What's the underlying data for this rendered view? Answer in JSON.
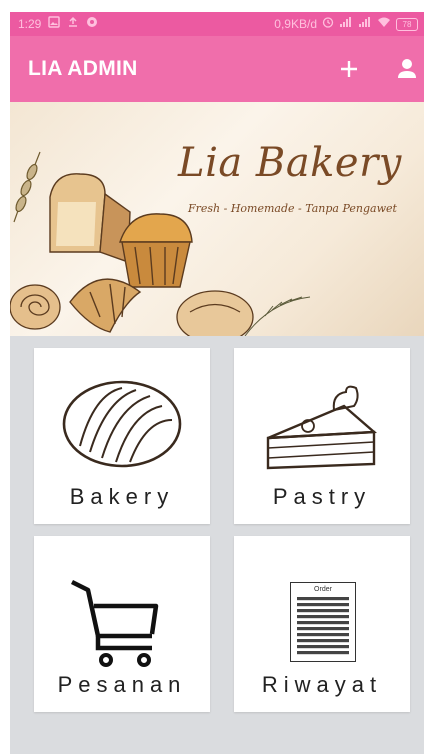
{
  "status_bar": {
    "time": "1:29",
    "network_speed": "0,9KB/d",
    "battery": "78",
    "icons": [
      "gallery-notification-icon",
      "upload-icon",
      "app-notification-icon",
      "alarm-icon",
      "signal-icon",
      "signal-icon",
      "wifi-icon",
      "battery-icon"
    ]
  },
  "app_bar": {
    "title": "LIA ADMIN",
    "actions": [
      "add-icon",
      "account-icon"
    ]
  },
  "banner": {
    "brand": "Lia Bakery",
    "tagline": "Fresh - Homemade - Tanpa Pengawet"
  },
  "menu": [
    {
      "label": "Bakery",
      "icon": "bread-icon"
    },
    {
      "label": "Pastry",
      "icon": "cake-slice-icon"
    },
    {
      "label": "Pesanan",
      "icon": "shopping-cart-icon"
    },
    {
      "label": "Riwayat",
      "icon": "order-document-icon",
      "icon_text": "Order"
    }
  ],
  "colors": {
    "status_bar": "#ec5aa1",
    "app_bar": "#f06eab",
    "background": "#dadcdf",
    "brand_text": "#7a4a26"
  }
}
